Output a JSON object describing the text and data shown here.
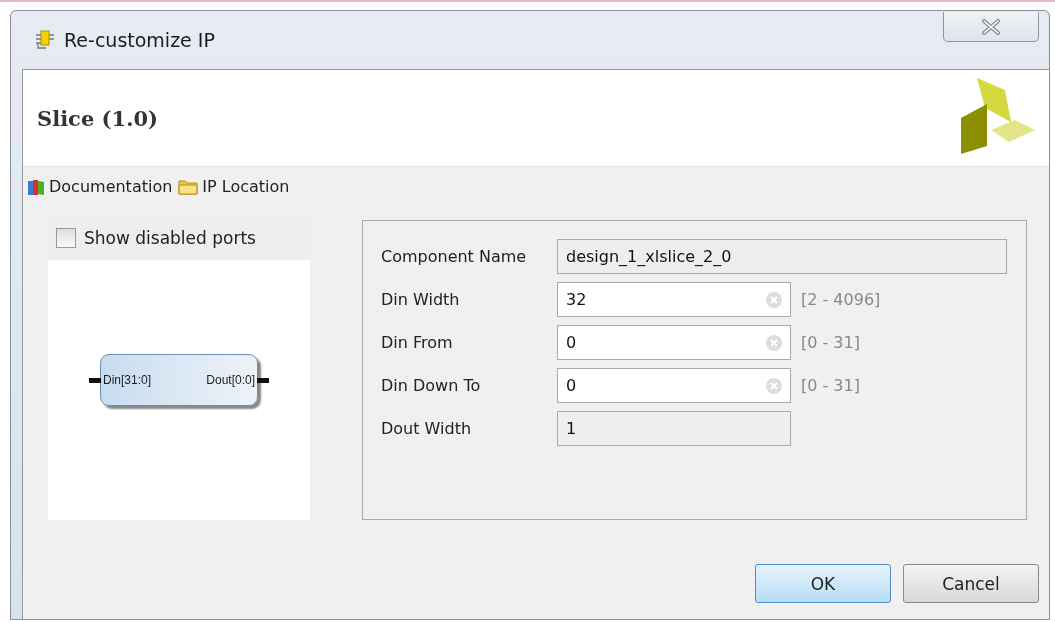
{
  "window": {
    "title": "Re-customize IP"
  },
  "header": {
    "title": "Slice (1.0)"
  },
  "toolbar": [
    {
      "kind": "books",
      "label": "Documentation"
    },
    {
      "kind": "folder",
      "label": "IP Location"
    }
  ],
  "symbol_panel": {
    "show_disabled_ports": {
      "label": "Show disabled ports",
      "checked": false
    },
    "block": {
      "input_port": "Din[31:0]",
      "output_port": "Dout[0:0]"
    }
  },
  "fields": [
    {
      "label": "Component Name",
      "value": "design_1_xlslice_2_0",
      "editable": false,
      "wide": true
    },
    {
      "label": "Din Width",
      "value": "32",
      "editable": true,
      "range": "[2 - 4096]"
    },
    {
      "label": "Din From",
      "value": "0",
      "editable": true,
      "range": "[0 - 31]"
    },
    {
      "label": "Din Down To",
      "value": "0",
      "editable": true,
      "range": "[0 - 31]"
    },
    {
      "label": "Dout Width",
      "value": "1",
      "editable": false
    }
  ],
  "buttons": [
    {
      "label": "OK",
      "default": true
    },
    {
      "label": "Cancel",
      "default": false
    }
  ]
}
